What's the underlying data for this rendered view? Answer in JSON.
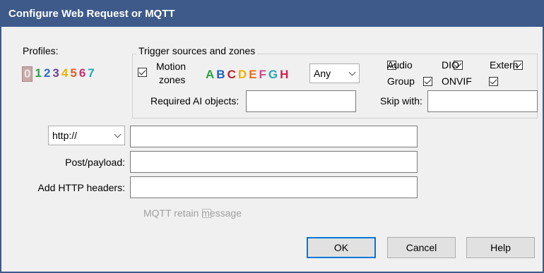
{
  "dialog": {
    "title": "Configure Web Request or MQTT"
  },
  "profiles": {
    "label": "Profiles:",
    "items": [
      {
        "text": "0",
        "color": "#e8e8e8"
      },
      {
        "text": "1",
        "color": "#2e9e4a"
      },
      {
        "text": "2",
        "color": "#2e6fc9"
      },
      {
        "text": "3",
        "color": "#6b3fa0"
      },
      {
        "text": "4",
        "color": "#e8b400"
      },
      {
        "text": "5",
        "color": "#e06020"
      },
      {
        "text": "6",
        "color": "#c83070"
      },
      {
        "text": "7",
        "color": "#20a8b8"
      }
    ]
  },
  "trigger": {
    "group_title": "Trigger sources and zones",
    "motion": {
      "label_line1": "Motion",
      "label_line2": "zones",
      "checked": true
    },
    "zones": [
      {
        "text": "A",
        "color": "#2ea043"
      },
      {
        "text": "B",
        "color": "#2060c0"
      },
      {
        "text": "C",
        "color": "#c02030"
      },
      {
        "text": "D",
        "color": "#f0b000"
      },
      {
        "text": "E",
        "color": "#e87020"
      },
      {
        "text": "F",
        "color": "#d04a8a"
      },
      {
        "text": "G",
        "color": "#28a8b0"
      },
      {
        "text": "H",
        "color": "#d02050"
      }
    ],
    "zone_select": "Any",
    "checkboxes": {
      "audio": {
        "label": "Audio",
        "checked": true
      },
      "dio": {
        "label": "DIO",
        "checked": true
      },
      "extern": {
        "label": "Extern",
        "checked": true
      },
      "group": {
        "label": "Group",
        "checked": true
      },
      "onvif": {
        "label": "ONVIF",
        "checked": true
      }
    },
    "required_ai_label": "Required AI objects:",
    "required_ai_value": "",
    "skip_with_label": "Skip with:",
    "skip_with_value": ""
  },
  "request": {
    "protocol": "http://",
    "url": "",
    "post_label": "Post/payload:",
    "post_value": "",
    "headers_label": "Add HTTP headers:",
    "headers_value": ""
  },
  "mqtt_retain": {
    "label": "MQTT retain message",
    "checked": false,
    "enabled": false
  },
  "buttons": {
    "ok": "OK",
    "cancel": "Cancel",
    "help": "Help"
  }
}
